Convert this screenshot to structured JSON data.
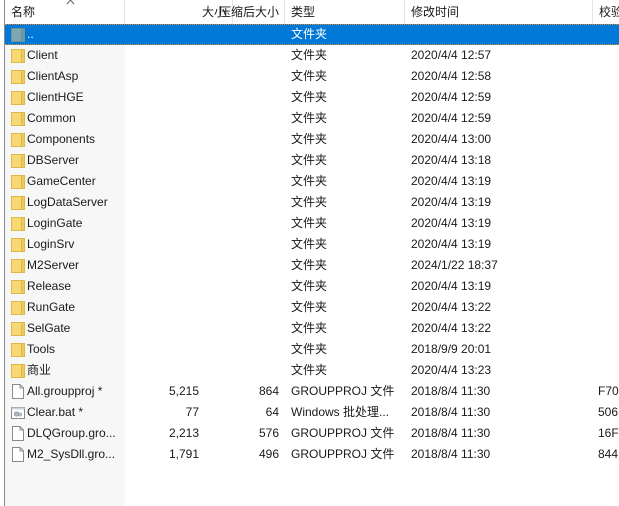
{
  "header": {
    "columns": [
      {
        "key": "name",
        "label": "名称"
      },
      {
        "key": "size",
        "label": "大小"
      },
      {
        "key": "csize",
        "label": "压缩后大小"
      },
      {
        "key": "type",
        "label": "类型"
      },
      {
        "key": "mtime",
        "label": "修改时间"
      },
      {
        "key": "crc",
        "label": "校验"
      }
    ],
    "sort_icon": "sort-ascending-caret"
  },
  "colors": {
    "selection": "#0078d7",
    "folder": "#f8d775",
    "parent_folder": "#7fa7b0"
  },
  "rows": [
    {
      "name": "..",
      "size": "",
      "csize": "",
      "type": "文件夹",
      "mtime": "",
      "crc": "",
      "icon": "parent-folder",
      "selected": true
    },
    {
      "name": "Client",
      "size": "",
      "csize": "",
      "type": "文件夹",
      "mtime": "2020/4/4 12:57",
      "crc": "",
      "icon": "folder"
    },
    {
      "name": "ClientAsp",
      "size": "",
      "csize": "",
      "type": "文件夹",
      "mtime": "2020/4/4 12:58",
      "crc": "",
      "icon": "folder"
    },
    {
      "name": "ClientHGE",
      "size": "",
      "csize": "",
      "type": "文件夹",
      "mtime": "2020/4/4 12:59",
      "crc": "",
      "icon": "folder"
    },
    {
      "name": "Common",
      "size": "",
      "csize": "",
      "type": "文件夹",
      "mtime": "2020/4/4 12:59",
      "crc": "",
      "icon": "folder"
    },
    {
      "name": "Components",
      "size": "",
      "csize": "",
      "type": "文件夹",
      "mtime": "2020/4/4 13:00",
      "crc": "",
      "icon": "folder"
    },
    {
      "name": "DBServer",
      "size": "",
      "csize": "",
      "type": "文件夹",
      "mtime": "2020/4/4 13:18",
      "crc": "",
      "icon": "folder"
    },
    {
      "name": "GameCenter",
      "size": "",
      "csize": "",
      "type": "文件夹",
      "mtime": "2020/4/4 13:19",
      "crc": "",
      "icon": "folder"
    },
    {
      "name": "LogDataServer",
      "size": "",
      "csize": "",
      "type": "文件夹",
      "mtime": "2020/4/4 13:19",
      "crc": "",
      "icon": "folder"
    },
    {
      "name": "LoginGate",
      "size": "",
      "csize": "",
      "type": "文件夹",
      "mtime": "2020/4/4 13:19",
      "crc": "",
      "icon": "folder"
    },
    {
      "name": "LoginSrv",
      "size": "",
      "csize": "",
      "type": "文件夹",
      "mtime": "2020/4/4 13:19",
      "crc": "",
      "icon": "folder"
    },
    {
      "name": "M2Server",
      "size": "",
      "csize": "",
      "type": "文件夹",
      "mtime": "2024/1/22 18:37",
      "crc": "",
      "icon": "folder"
    },
    {
      "name": "Release",
      "size": "",
      "csize": "",
      "type": "文件夹",
      "mtime": "2020/4/4 13:19",
      "crc": "",
      "icon": "folder"
    },
    {
      "name": "RunGate",
      "size": "",
      "csize": "",
      "type": "文件夹",
      "mtime": "2020/4/4 13:22",
      "crc": "",
      "icon": "folder"
    },
    {
      "name": "SelGate",
      "size": "",
      "csize": "",
      "type": "文件夹",
      "mtime": "2020/4/4 13:22",
      "crc": "",
      "icon": "folder"
    },
    {
      "name": "Tools",
      "size": "",
      "csize": "",
      "type": "文件夹",
      "mtime": "2018/9/9 20:01",
      "crc": "",
      "icon": "folder"
    },
    {
      "name": "商业",
      "size": "",
      "csize": "",
      "type": "文件夹",
      "mtime": "2020/4/4 13:23",
      "crc": "",
      "icon": "folder"
    },
    {
      "name": "All.groupproj *",
      "size": "5,215",
      "csize": "864",
      "type": "GROUPPROJ 文件",
      "mtime": "2018/8/4 11:30",
      "crc": "F70",
      "icon": "file"
    },
    {
      "name": "Clear.bat *",
      "size": "77",
      "csize": "64",
      "type": "Windows 批处理...",
      "mtime": "2018/8/4 11:30",
      "crc": "506",
      "icon": "batch-file"
    },
    {
      "name": "DLQGroup.gro...",
      "size": "2,213",
      "csize": "576",
      "type": "GROUPPROJ 文件",
      "mtime": "2018/8/4 11:30",
      "crc": "16F",
      "icon": "file"
    },
    {
      "name": "M2_SysDll.gro...",
      "size": "1,791",
      "csize": "496",
      "type": "GROUPPROJ 文件",
      "mtime": "2018/8/4 11:30",
      "crc": "844",
      "icon": "file"
    }
  ]
}
